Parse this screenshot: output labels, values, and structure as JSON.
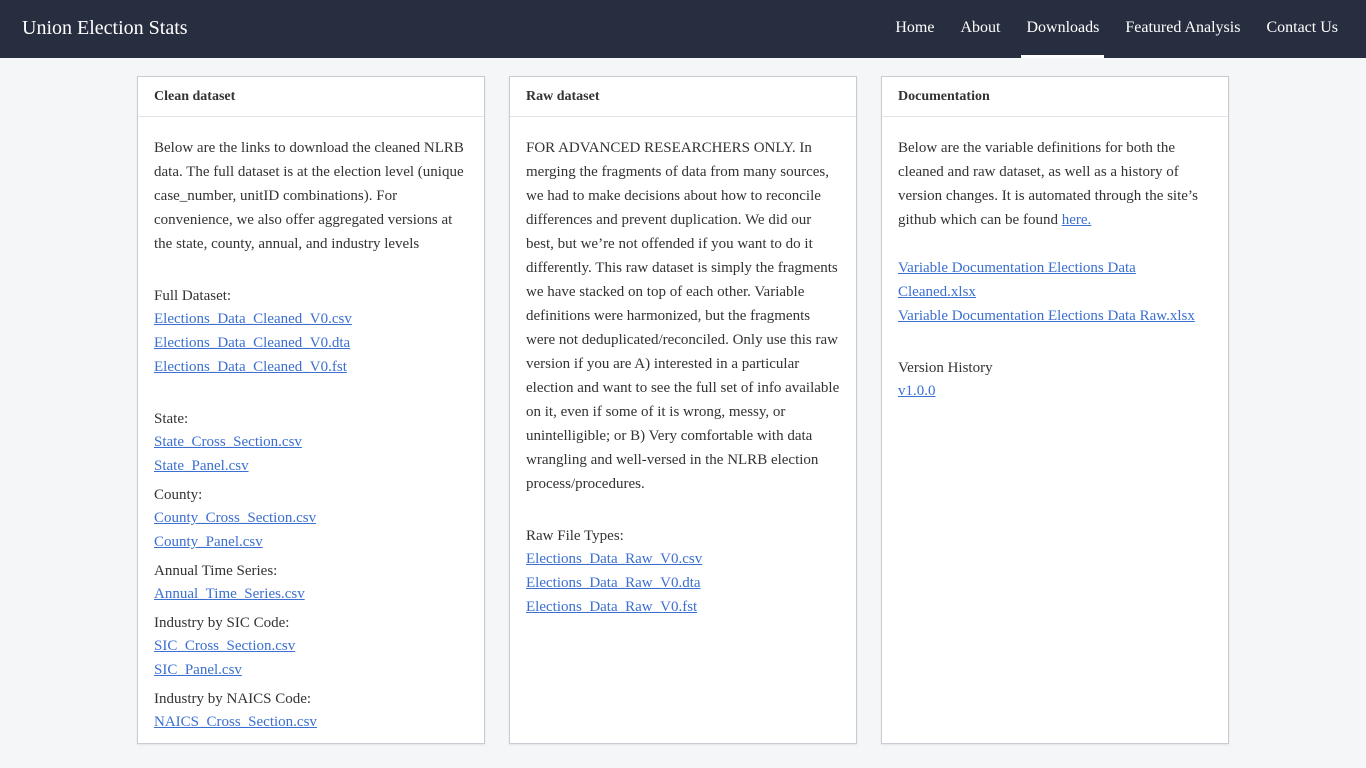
{
  "nav": {
    "brand": "Union Election Stats",
    "items": [
      {
        "label": "Home"
      },
      {
        "label": "About"
      },
      {
        "label": "Downloads",
        "active": true
      },
      {
        "label": "Featured Analysis"
      },
      {
        "label": "Contact Us"
      }
    ]
  },
  "clean": {
    "title": "Clean dataset",
    "intro": "Below are the links to download the cleaned NLRB data. The full dataset is at the election level (unique case_number, unitID combinations). For convenience, we also offer aggregated versions at the state, county, annual, and industry levels",
    "full_label": "Full Dataset:",
    "full_files": [
      "Elections_Data_Cleaned_V0.csv",
      "Elections_Data_Cleaned_V0.dta",
      "Elections_Data_Cleaned_V0.fst"
    ],
    "state_label": "State:",
    "state_files": [
      "State_Cross_Section.csv",
      "State_Panel.csv"
    ],
    "county_label": "County:",
    "county_files": [
      "County_Cross_Section.csv",
      "County_Panel.csv"
    ],
    "annual_label": "Annual Time Series:",
    "annual_files": [
      "Annual_Time_Series.csv"
    ],
    "sic_label": "Industry by SIC Code:",
    "sic_files": [
      "SIC_Cross_Section.csv",
      "SIC_Panel.csv"
    ],
    "naics_label": "Industry by NAICS Code:",
    "naics_files": [
      "NAICS_Cross_Section.csv"
    ]
  },
  "raw": {
    "title": "Raw dataset",
    "intro": "FOR ADVANCED RESEARCHERS ONLY. In merging the fragments of data from many sources, we had to make decisions about how to reconcile differences and prevent duplication. We did our best, but we’re not offended if you want to do it differently. This raw dataset is simply the fragments we have stacked on top of each other. Variable definitions were harmonized, but the fragments were not deduplicated/reconciled. Only use this raw version if you are A) interested in a particular election and want to see the full set of info available on it, even if some of it is wrong, messy, or unintelligible; or B) Very comfortable with data wrangling and well-versed in the NLRB election process/procedures.",
    "types_label": "Raw File Types:",
    "files": [
      "Elections_Data_Raw_V0.csv",
      "Elections_Data_Raw_V0.dta",
      "Elections_Data_Raw_V0.fst"
    ]
  },
  "docs": {
    "title": "Documentation",
    "intro": "Below are the variable definitions for both the cleaned and raw dataset, as well as a history of version changes. It is automated through the site’s github which can be found ",
    "here_link": "here.",
    "files": [
      "Variable Documentation Elections Data Cleaned.xlsx",
      "Variable Documentation Elections Data Raw.xlsx"
    ],
    "version_label": "Version History",
    "version_link": "v1.0.0"
  }
}
